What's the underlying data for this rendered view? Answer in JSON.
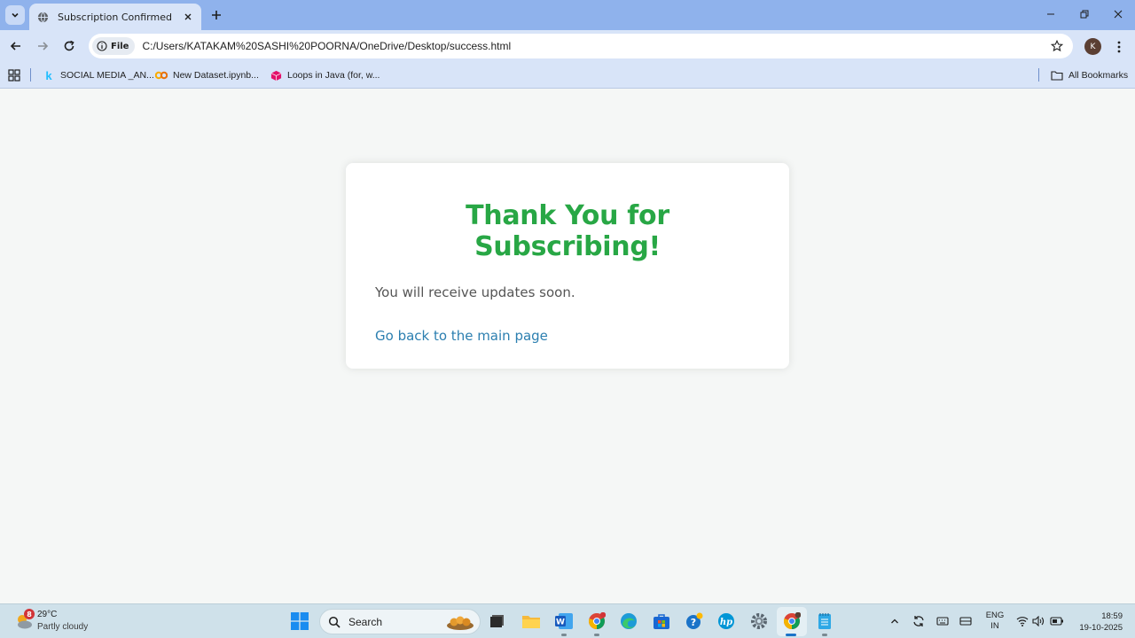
{
  "browser": {
    "tab_title": "Subscription Confirmed",
    "address_chip": "File",
    "url": "C:/Users/KATAKAM%20SASHI%20POORNA/OneDrive/Desktop/success.html",
    "profile_initial": "K",
    "bookmarks": [
      {
        "label": "SOCIAL MEDIA _AN..."
      },
      {
        "label": "New Dataset.ipynb..."
      },
      {
        "label": "Loops in Java (for, w..."
      }
    ],
    "all_bookmarks_label": "All Bookmarks"
  },
  "page": {
    "heading": "Thank You for Subscribing!",
    "message": "You will receive updates soon.",
    "back_link": "Go back to the main page"
  },
  "taskbar": {
    "weather": {
      "badge": "8",
      "temp": "29°C",
      "desc": "Partly cloudy"
    },
    "search_label": "Search",
    "lang_line1": "ENG",
    "lang_line2": "IN",
    "time": "18:59",
    "date": "19-10-2025"
  },
  "colors": {
    "heading_green": "#28a745",
    "link_blue": "#2c7fb0",
    "tab_strip": "#8fb2ec",
    "toolbar": "#d8e4f8",
    "taskbar": "#cfe1ea"
  }
}
